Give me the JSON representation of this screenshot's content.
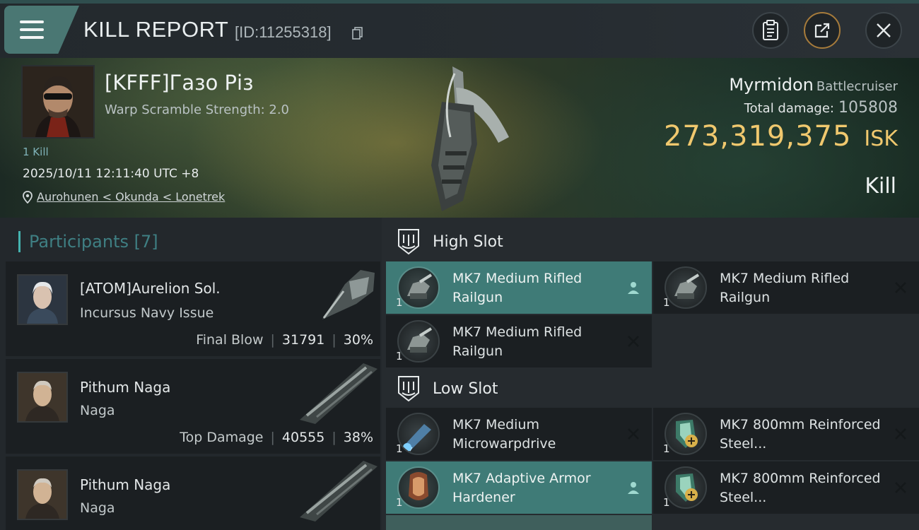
{
  "header": {
    "title": "KILL REPORT",
    "report_id": "[ID:11255318]",
    "icons": [
      "menu-icon",
      "copy-icon",
      "clipboard-icon",
      "share-icon",
      "close-icon"
    ]
  },
  "victim": {
    "name": "[KFFF]Газо Різ",
    "warp_scramble": "Warp Scramble Strength: 2.0",
    "kills": "1 Kill",
    "datetime": "2025/10/11 12:11:40 UTC +8",
    "location": "Aurohunen < Okunda < Lonetrek",
    "ship_name": "Myrmidon",
    "ship_class": "Battlecruiser",
    "total_damage_label": "Total damage:",
    "total_damage": "105808",
    "isk_value": "273,319,375",
    "isk_unit": "ISK",
    "result": "Kill"
  },
  "participants": {
    "header": "Participants [7]",
    "rows": [
      {
        "name": "[ATOM]Aurelion Sol.",
        "ship": "Incursus Navy Issue",
        "tag": "Final Blow",
        "damage": "31791",
        "percent": "30%"
      },
      {
        "name": "Pithum Naga",
        "ship": "Naga",
        "tag": "Top Damage",
        "damage": "40555",
        "percent": "38%"
      },
      {
        "name": "Pithum Naga",
        "ship": "Naga",
        "tag": "",
        "damage": "",
        "percent": ""
      }
    ]
  },
  "fitting": {
    "high_slot": {
      "label": "High Slot",
      "modules": [
        {
          "name": "MK7 Medium Rifled Railgun",
          "qty": "1",
          "status": "person-icon"
        },
        {
          "name": "MK7 Medium Rifled Railgun",
          "qty": "1",
          "status": "close-x-icon"
        },
        {
          "name": "MK7 Medium Rifled Railgun",
          "qty": "1",
          "status": "close-x-icon"
        }
      ]
    },
    "low_slot": {
      "label": "Low Slot",
      "modules": [
        {
          "name": "MK7 Medium Microwarpdrive",
          "qty": "1",
          "status": "close-x-icon"
        },
        {
          "name": "MK7 800mm Reinforced Steel...",
          "qty": "1",
          "status": "close-x-icon"
        },
        {
          "name": "MK7 Adaptive Armor Hardener",
          "qty": "1",
          "status": "person-icon"
        },
        {
          "name": "MK7 800mm Reinforced Steel...",
          "qty": "1",
          "status": "close-x-icon"
        }
      ]
    }
  },
  "colors": {
    "accent_teal": "#3f7b77",
    "isk_gold": "#f0c86e",
    "participants_header": "#3f7f83"
  }
}
